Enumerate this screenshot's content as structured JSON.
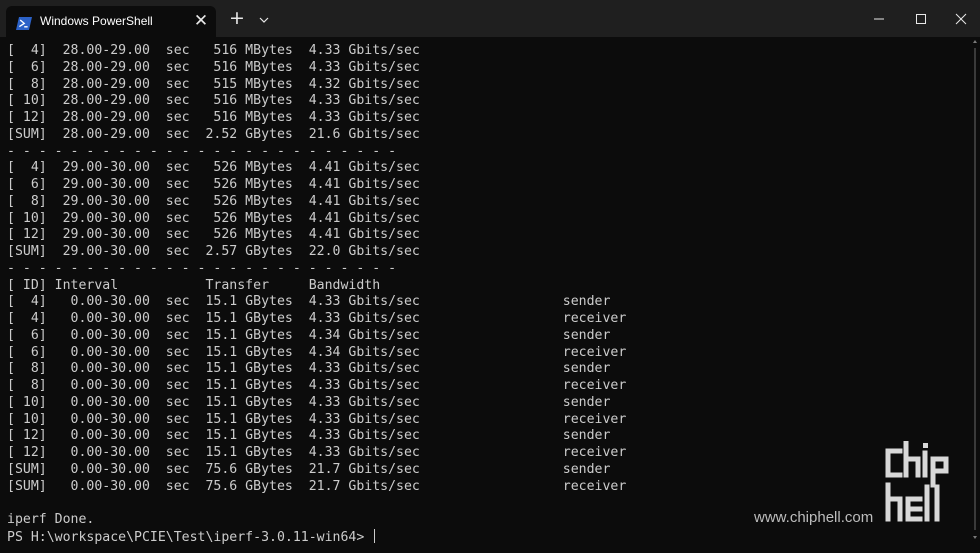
{
  "window": {
    "tab_title": "Windows PowerShell",
    "icons": {
      "tab": "powershell-icon",
      "close_tab": "close-icon",
      "new_tab": "plus-icon",
      "dropdown": "chevron-down-icon",
      "minimize": "minimize-icon",
      "maximize": "maximize-icon",
      "close": "close-icon"
    },
    "symbols": {
      "close_tab": "✕",
      "new_tab": "+"
    }
  },
  "terminal": {
    "lines": [
      "[  4]  28.00-29.00  sec   516 MBytes  4.33 Gbits/sec",
      "[  6]  28.00-29.00  sec   516 MBytes  4.33 Gbits/sec",
      "[  8]  28.00-29.00  sec   515 MBytes  4.32 Gbits/sec",
      "[ 10]  28.00-29.00  sec   516 MBytes  4.33 Gbits/sec",
      "[ 12]  28.00-29.00  sec   516 MBytes  4.33 Gbits/sec",
      "[SUM]  28.00-29.00  sec  2.52 GBytes  21.6 Gbits/sec",
      "- - - - - - - - - - - - - - - - - - - - - - - - -",
      "[  4]  29.00-30.00  sec   526 MBytes  4.41 Gbits/sec",
      "[  6]  29.00-30.00  sec   526 MBytes  4.41 Gbits/sec",
      "[  8]  29.00-30.00  sec   526 MBytes  4.41 Gbits/sec",
      "[ 10]  29.00-30.00  sec   526 MBytes  4.41 Gbits/sec",
      "[ 12]  29.00-30.00  sec   526 MBytes  4.41 Gbits/sec",
      "[SUM]  29.00-30.00  sec  2.57 GBytes  22.0 Gbits/sec",
      "- - - - - - - - - - - - - - - - - - - - - - - - -",
      "[ ID] Interval           Transfer     Bandwidth",
      "[  4]   0.00-30.00  sec  15.1 GBytes  4.33 Gbits/sec                  sender",
      "[  4]   0.00-30.00  sec  15.1 GBytes  4.33 Gbits/sec                  receiver",
      "[  6]   0.00-30.00  sec  15.1 GBytes  4.34 Gbits/sec                  sender",
      "[  6]   0.00-30.00  sec  15.1 GBytes  4.34 Gbits/sec                  receiver",
      "[  8]   0.00-30.00  sec  15.1 GBytes  4.33 Gbits/sec                  sender",
      "[  8]   0.00-30.00  sec  15.1 GBytes  4.33 Gbits/sec                  receiver",
      "[ 10]   0.00-30.00  sec  15.1 GBytes  4.33 Gbits/sec                  sender",
      "[ 10]   0.00-30.00  sec  15.1 GBytes  4.33 Gbits/sec                  receiver",
      "[ 12]   0.00-30.00  sec  15.1 GBytes  4.33 Gbits/sec                  sender",
      "[ 12]   0.00-30.00  sec  15.1 GBytes  4.33 Gbits/sec                  receiver",
      "[SUM]   0.00-30.00  sec  75.6 GBytes  21.7 Gbits/sec                  sender",
      "[SUM]   0.00-30.00  sec  75.6 GBytes  21.7 Gbits/sec                  receiver",
      "",
      "iperf Done."
    ],
    "prompt": "PS H:\\workspace\\PCIE\\Test\\iperf-3.0.11-win64> "
  },
  "watermark": {
    "text": "www.chiphell.com",
    "logo": "chiphell-logo"
  },
  "colors": {
    "background": "#0c0c0c",
    "titlebar": "#1f1f1f",
    "text": "#cccccc",
    "powershell_blue": "#2c62c8"
  }
}
